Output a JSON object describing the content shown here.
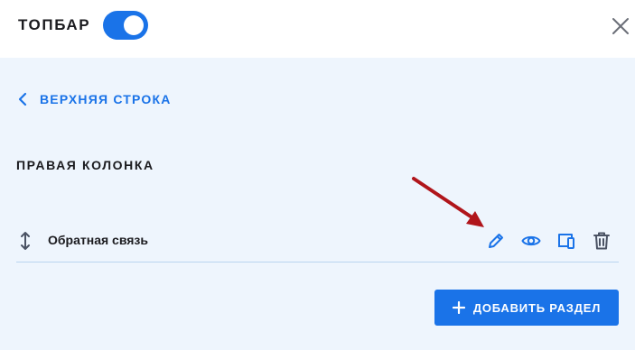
{
  "header": {
    "title": "ТОПБАР",
    "toggle_on": true,
    "close_icon": "close-icon"
  },
  "nav": {
    "back_label": "ВЕРХНЯЯ СТРОКА",
    "back_icon": "chevron-left-icon"
  },
  "section": {
    "title": "ПРАВАЯ КОЛОНКА"
  },
  "rows": [
    {
      "label": "Обратная связь",
      "icons": [
        "drag-handle-icon",
        "pencil-icon",
        "eye-icon",
        "devices-icon",
        "trash-icon"
      ]
    }
  ],
  "add_button": {
    "label": "ДОБАВИТЬ РАЗДЕЛ",
    "icon": "plus-icon"
  },
  "colors": {
    "accent": "#1a73e8",
    "header_bg": "#ffffff",
    "body_bg": "#eef5fd",
    "annotation_arrow": "#b0151b"
  }
}
